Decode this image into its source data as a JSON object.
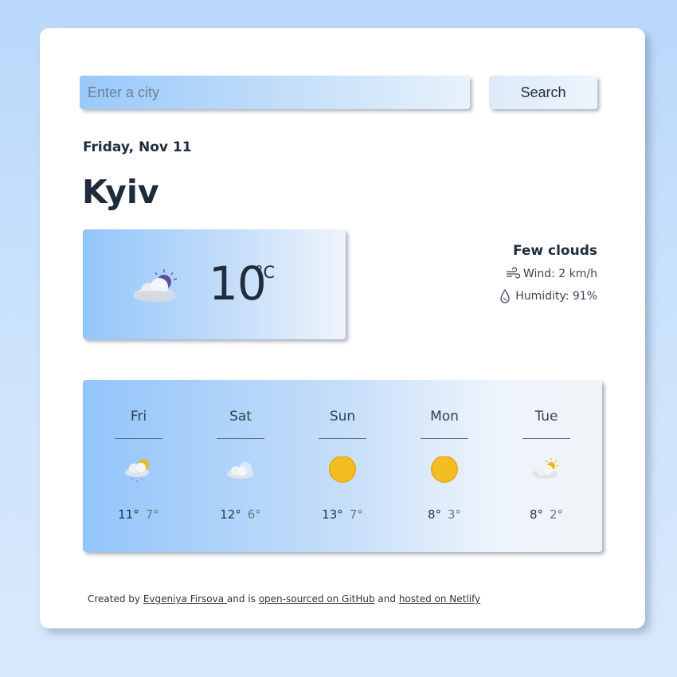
{
  "search": {
    "placeholder": "Enter a city",
    "button_label": "Search"
  },
  "current": {
    "date": "Friday, Nov 11",
    "city": "Kyiv",
    "temperature": "10",
    "unit": "°C",
    "icon": "few-clouds-night-icon",
    "description": "Few clouds",
    "wind": "Wind: 2 km/h",
    "humidity": "Humidity: 91%"
  },
  "forecast": [
    {
      "day": "Fri",
      "max": "11°",
      "min": "7°",
      "icon": "rain-cloud-sun-icon"
    },
    {
      "day": "Sat",
      "max": "12°",
      "min": "6°",
      "icon": "cloud-icon"
    },
    {
      "day": "Sun",
      "max": "13°",
      "min": "7°",
      "icon": "sun-icon"
    },
    {
      "day": "Mon",
      "max": "8°",
      "min": "3°",
      "icon": "sun-icon"
    },
    {
      "day": "Tue",
      "max": "8°",
      "min": "2°",
      "icon": "cloud-sun-icon"
    }
  ],
  "footer": {
    "prefix": "Created by ",
    "author": "Evgeniya Firsova ",
    "middle1": " and is ",
    "github": "open-sourced on GitHub",
    "middle2": " and ",
    "netlify": "hosted on Netlify"
  },
  "colors": {
    "accent_gradient_start": "#93c5fb",
    "accent_gradient_end": "#eef4fb",
    "text": "#1f2d3d",
    "sun": "#f2b51c"
  }
}
